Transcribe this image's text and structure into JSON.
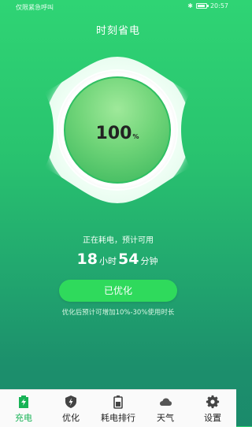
{
  "status_bar": {
    "carrier": "仅限紧急呼叫",
    "time": "20:57"
  },
  "app": {
    "title": "时刻省电"
  },
  "battery": {
    "level_number": "100",
    "level_unit": "%",
    "status": "正在耗电，预计可用",
    "hours": "18",
    "hours_unit": "小时",
    "minutes": "54",
    "minutes_unit": "分钟"
  },
  "optimize": {
    "button_label": "已优化",
    "tip": "优化后预计可增加10%-30%使用时长"
  },
  "nav": {
    "items": [
      {
        "label": "充电",
        "icon": "battery-charge-icon"
      },
      {
        "label": "优化",
        "icon": "shield-lightning-icon"
      },
      {
        "label": "耗电排行",
        "icon": "battery-icon"
      },
      {
        "label": "天气",
        "icon": "cloud-icon"
      },
      {
        "label": "设置",
        "icon": "gear-icon"
      }
    ]
  },
  "colors": {
    "accent": "#18b356",
    "button": "#2fda5c"
  }
}
